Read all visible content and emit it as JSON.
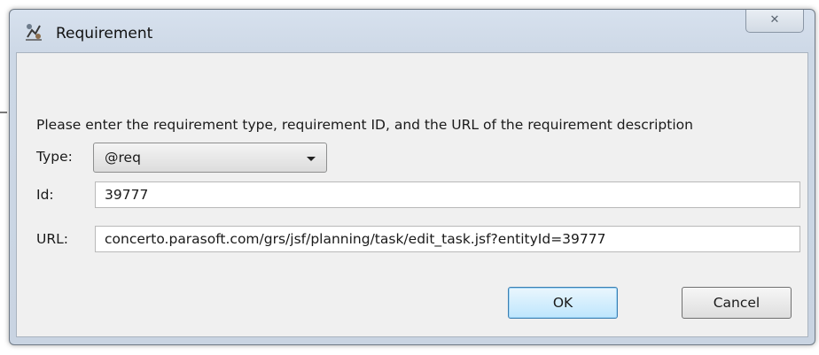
{
  "window": {
    "title": "Requirement",
    "close_glyph": "✕"
  },
  "prompt": "Please enter the requirement type, requirement ID, and the URL of the requirement description",
  "form": {
    "type_label": "Type:",
    "type_value": "@req",
    "id_label": "Id:",
    "id_value": "39777",
    "url_label": "URL:",
    "url_value": "concerto.parasoft.com/grs/jsf/planning/task/edit_task.jsf?entityId=39777"
  },
  "buttons": {
    "ok_label": "OK",
    "cancel_label": "Cancel"
  },
  "icons": {
    "title_icon": "requirement-icon",
    "dropdown_icon": "chevron-down-icon"
  },
  "colors": {
    "ok_accent": "#3c7fb1",
    "window_frame": "#cdd8e6"
  }
}
